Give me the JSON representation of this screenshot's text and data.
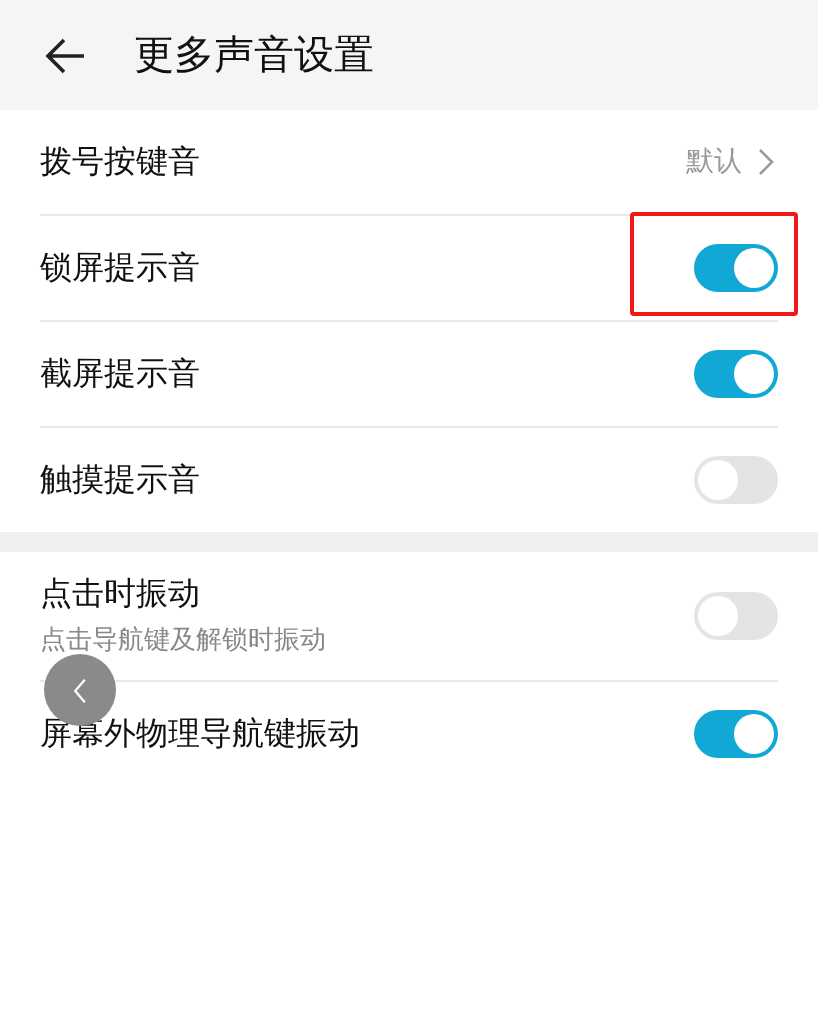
{
  "header": {
    "title": "更多声音设置"
  },
  "sections": [
    {
      "rows": [
        {
          "kind": "link",
          "label": "拨号按键音",
          "value": "默认",
          "highlighted": false
        },
        {
          "kind": "toggle",
          "label": "锁屏提示音",
          "on": true,
          "highlighted": true
        },
        {
          "kind": "toggle",
          "label": "截屏提示音",
          "on": true,
          "highlighted": false
        },
        {
          "kind": "toggle",
          "label": "触摸提示音",
          "on": false,
          "highlighted": false
        }
      ]
    },
    {
      "rows": [
        {
          "kind": "toggle",
          "label": "点击时振动",
          "subtitle": "点击导航键及解锁时振动",
          "on": false,
          "highlighted": false
        },
        {
          "kind": "toggle",
          "label": "屏幕外物理导航键振动",
          "on": true,
          "highlighted": false
        }
      ]
    }
  ]
}
